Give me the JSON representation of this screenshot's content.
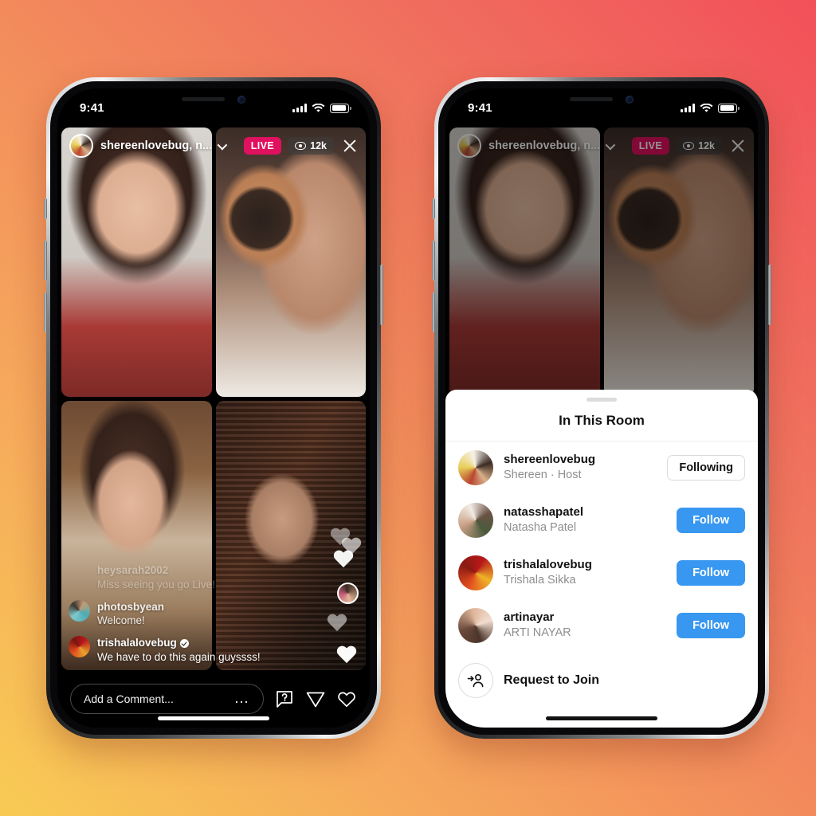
{
  "background": {
    "gradient_from": "#F8CB54",
    "gradient_mid": "#F28A5C",
    "gradient_to": "#F2505A"
  },
  "status_bar": {
    "time": "9:41",
    "signal": "signal-bars",
    "wifi": "wifi",
    "battery": "battery-full"
  },
  "live": {
    "header": {
      "avatar": "shereenlovebug-avatar",
      "title": "shereenlovebug, n...",
      "chevron": "chevron-down-icon",
      "live_label": "LIVE",
      "viewer_icon": "eye-icon",
      "viewer_count": "12k",
      "close": "close-icon"
    },
    "tiles": [
      {
        "name": "video-tile-1",
        "alt": "host front camera"
      },
      {
        "name": "video-tile-2",
        "alt": "guest applying powder"
      },
      {
        "name": "video-tile-3",
        "alt": "guest applying blush"
      },
      {
        "name": "video-tile-4",
        "alt": "guest in dark room"
      }
    ],
    "comments": [
      {
        "user": "heysarah2002",
        "text": "Miss seeing you go Live!",
        "verified": false,
        "avatar": "none",
        "fade": "faded"
      },
      {
        "user": "photosbyean",
        "text": "Welcome!",
        "verified": false,
        "avatar": "teal",
        "fade": "half"
      },
      {
        "user": "trishalalovebug",
        "text": "We have to do this again guyssss!",
        "verified": true,
        "avatar": "red",
        "fade": "full"
      }
    ],
    "bottom_bar": {
      "comment_placeholder": "Add a Comment...",
      "more_icon": "ellipsis-icon",
      "question_icon": "question-box-icon",
      "send_icon": "paper-plane-icon",
      "like_icon": "heart-icon"
    },
    "hearts_icon": "floating-hearts"
  },
  "sheet": {
    "grabber": "drag-handle",
    "title": "In This Room",
    "participants": [
      {
        "username": "shereenlovebug",
        "subtitle": "Shereen · Host",
        "action": "Following",
        "action_style": "outline",
        "avatar": "shereen"
      },
      {
        "username": "natasshapatel",
        "subtitle": "Natasha Patel",
        "action": "Follow",
        "action_style": "primary",
        "avatar": "natassha"
      },
      {
        "username": "trishalalovebug",
        "subtitle": "Trishala Sikka",
        "action": "Follow",
        "action_style": "primary",
        "avatar": "trishala"
      },
      {
        "username": "artinayar",
        "subtitle": "ARTI NAYAR",
        "action": "Follow",
        "action_style": "primary",
        "avatar": "arti"
      }
    ],
    "request_to_join": {
      "label": "Request to Join",
      "icon": "add-person-icon"
    },
    "follow_color": "#3897F0"
  }
}
